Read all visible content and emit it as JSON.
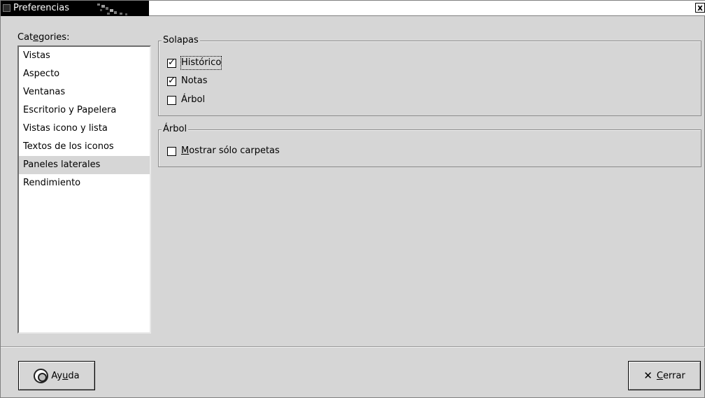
{
  "window": {
    "title": "Preferencias",
    "close_glyph": "x"
  },
  "categories": {
    "label_pre": "Cat",
    "label_mnemonic": "e",
    "label_post": "gories:",
    "items": [
      "Vistas",
      "Aspecto",
      "Ventanas",
      "Escritorio y Papelera",
      "Vistas icono y lista",
      "Textos de los iconos",
      "Paneles laterales",
      "Rendimiento"
    ],
    "selected": "Paneles laterales"
  },
  "solapas": {
    "legend": "Solapas",
    "options": [
      {
        "label": "Histórico",
        "checked": true
      },
      {
        "label": "Notas",
        "checked": true
      },
      {
        "label": "Árbol",
        "checked": false
      }
    ]
  },
  "arbol": {
    "legend": "Árbol",
    "option_mnemonic": "M",
    "option_rest": "ostrar sólo carpetas",
    "checked": false
  },
  "buttons": {
    "help_pre": "Ay",
    "help_mnemonic": "u",
    "help_post": "da",
    "close_mnemonic": "C",
    "close_post": "errar",
    "close_glyph": "✕"
  },
  "icons": {
    "help": "help-lifebuoy-icon",
    "close": "close-icon",
    "window_menu": "window-menu-icon"
  },
  "colors": {
    "background": "#d6d6d6",
    "selection": "#d6d6d6",
    "titlebar": "#000000"
  }
}
